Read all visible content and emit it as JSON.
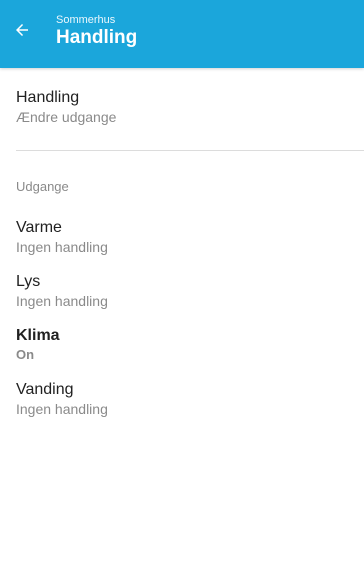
{
  "appbar": {
    "subtitle": "Sommerhus",
    "title": "Handling",
    "color": "#1BA6DB"
  },
  "action": {
    "label": "Handling",
    "value": "Ændre udgange"
  },
  "outputs": {
    "header": "Udgange",
    "items": [
      {
        "name": "Varme",
        "status": "Ingen handling"
      },
      {
        "name": "Lys",
        "status": "Ingen handling"
      },
      {
        "name": "Klima",
        "status": "On"
      },
      {
        "name": "Vanding",
        "status": "Ingen handling"
      }
    ]
  }
}
